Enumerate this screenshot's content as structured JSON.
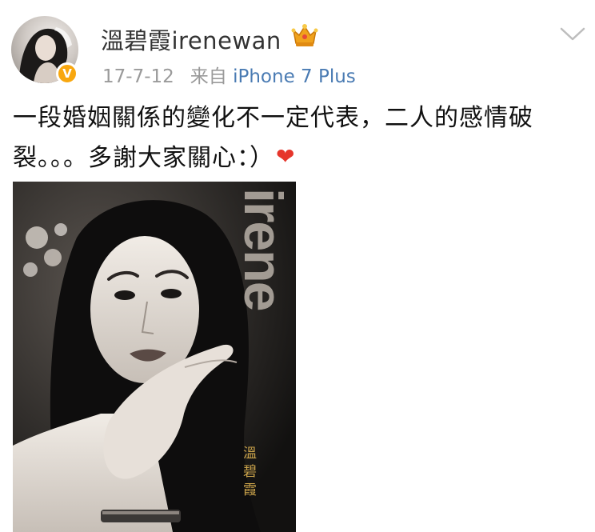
{
  "user": {
    "name": "溫碧霞irenewan",
    "badge_icon": "crown-icon",
    "verified_icon": "verified-v-icon",
    "verified_glyph": "V"
  },
  "meta": {
    "date": "17-7-12",
    "source_prefix": "来自",
    "source": "iPhone 7 Plus"
  },
  "post": {
    "text": "一段婚姻關係的變化不一定代表，二人的感情破裂。。。多謝大家關心：）",
    "emoji": "❤",
    "emoji_icon": "heart-icon"
  },
  "photo": {
    "brand_text": "irene",
    "name_text": "溫碧霞"
  },
  "menu_icon": "chevron-down-icon",
  "colors": {
    "link": "#4a7bb3",
    "meta": "#9a9a9a",
    "verified": "#f8a70f",
    "heart": "#e6352b",
    "crown": "#f0a21c"
  }
}
